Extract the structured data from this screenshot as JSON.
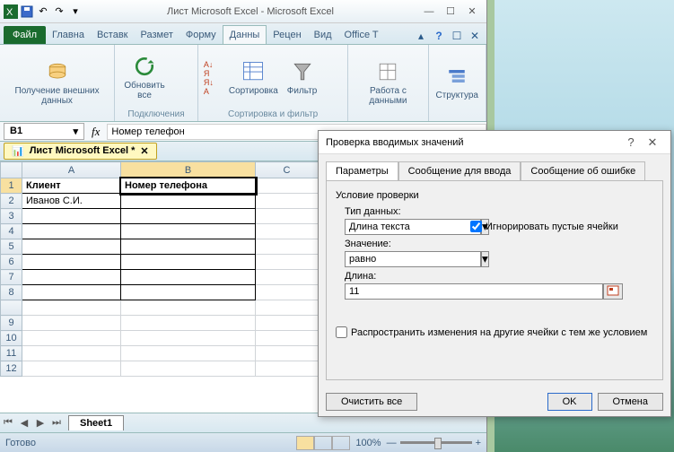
{
  "app": {
    "title": "Лист Microsoft Excel  -  Microsoft Excel",
    "tabs": {
      "file": "Файл",
      "items": [
        "Главна",
        "Вставк",
        "Размет",
        "Форму",
        "Данны",
        "Рецен",
        "Вид",
        "Office T"
      ],
      "active_index": 4
    }
  },
  "ribbon": {
    "g1": {
      "btn": "Получение внешних данных",
      "title": ""
    },
    "g2": {
      "btn": "Обновить все",
      "title": "Подключения"
    },
    "g3": {
      "sort": "Сортировка",
      "filter": "Фильтр",
      "title": "Сортировка и фильтр"
    },
    "g4": {
      "btn": "Работа с данными",
      "title": ""
    },
    "g5": {
      "btn": "Структура",
      "title": ""
    }
  },
  "formula": {
    "cellref": "B1",
    "fx": "fx",
    "value": "Номер телефон"
  },
  "doctab": "Лист Microsoft Excel *",
  "grid": {
    "cols": [
      "A",
      "B",
      "C"
    ],
    "rows": [
      "1",
      "2",
      "3",
      "4",
      "5",
      "6",
      "7",
      "8",
      "",
      "9",
      "10",
      "11",
      "12"
    ],
    "cells": {
      "a1": "Клиент",
      "b1": "Номер телефона",
      "a2": "Иванов С.И."
    }
  },
  "sheet": {
    "nav": [
      "⏮",
      "◀",
      "▶",
      "⏭"
    ],
    "tab": "Sheet1"
  },
  "status": {
    "text": "Готово",
    "zoom": "100%"
  },
  "dialog": {
    "title": "Проверка вводимых значений",
    "tabs": [
      "Параметры",
      "Сообщение для ввода",
      "Сообщение об ошибке"
    ],
    "section": "Условие проверки",
    "type_label": "Тип данных:",
    "type_value": "Длина текста",
    "ignore": "Игнорировать пустые ячейки",
    "value_label": "Значение:",
    "value_value": "равно",
    "length_label": "Длина:",
    "length_value": "11",
    "propagate": "Распространить изменения на другие ячейки с тем же условием",
    "clear": "Очистить все",
    "ok": "OK",
    "cancel": "Отмена"
  }
}
